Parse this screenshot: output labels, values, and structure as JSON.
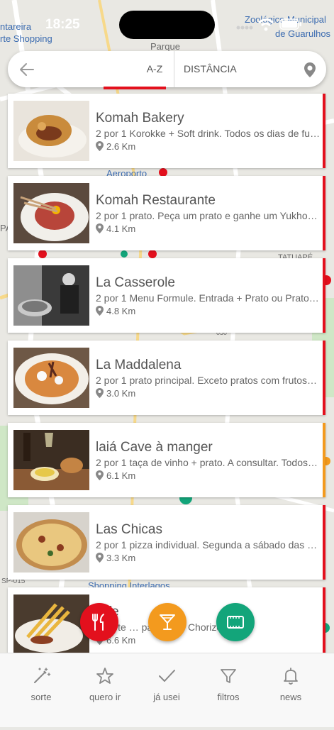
{
  "status": {
    "time": "18:25"
  },
  "map": {
    "labels": [
      "Zoológico Municipal",
      "de Guarulhos",
      "ntareira",
      "rte Shopping",
      "Parque",
      "Aeroporto",
      "TATUAPÉ",
      "Shopping Interlagos",
      "SP-015",
      "PA",
      "050"
    ]
  },
  "search": {
    "sort_az": "A-Z",
    "sort_distance": "DISTÂNCIA"
  },
  "restaurants": [
    {
      "name": "Komah Bakery",
      "desc": "2 por 1 Korokke + Soft drink. Todos os dias de fu…",
      "distance": "2.6 Km",
      "accent": "#e3101d"
    },
    {
      "name": "Komah Restaurante",
      "desc": "2 por 1 prato. Peça um prato e ganhe um Yukhoe…",
      "distance": "4.1 Km",
      "accent": "#e3101d"
    },
    {
      "name": "La Casserole",
      "desc": "2 por 1 Menu Formule. Entrada + Prato ou Prato…",
      "distance": "4.8 Km",
      "accent": "#e3101d"
    },
    {
      "name": "La Maddalena",
      "desc": "2 por 1 prato principal. Exceto pratos com frutos…",
      "distance": "3.0 Km",
      "accent": "#e3101d"
    },
    {
      "name": "laiá Cave à manger",
      "desc": "2 por 1 taça de vinho + prato. A consultar. Todos…",
      "distance": "6.1 Km",
      "accent": "#f39a1e"
    },
    {
      "name": "Las Chicas",
      "desc": "2 por 1 pizza individual. Segunda a sábado das 1…",
      "distance": "3.3 Km",
      "accent": "#e3101d"
    },
    {
      "name": "Bife",
      "desc": "1 corte … panhar … Chorizo, Filé…",
      "distance": "6.6 Km",
      "accent": "#e3101d"
    }
  ],
  "fabs": {
    "food": {
      "icon": "fork-knife-icon",
      "color": "#e3101d"
    },
    "drinks": {
      "icon": "cocktail-icon",
      "color": "#f39a1e"
    },
    "cinema": {
      "icon": "film-ticket-icon",
      "color": "#13a57a"
    }
  },
  "nav": {
    "sorte": "sorte",
    "quero_ir": "quero ir",
    "ja_usei": "já usei",
    "filtros": "filtros",
    "news": "news"
  }
}
